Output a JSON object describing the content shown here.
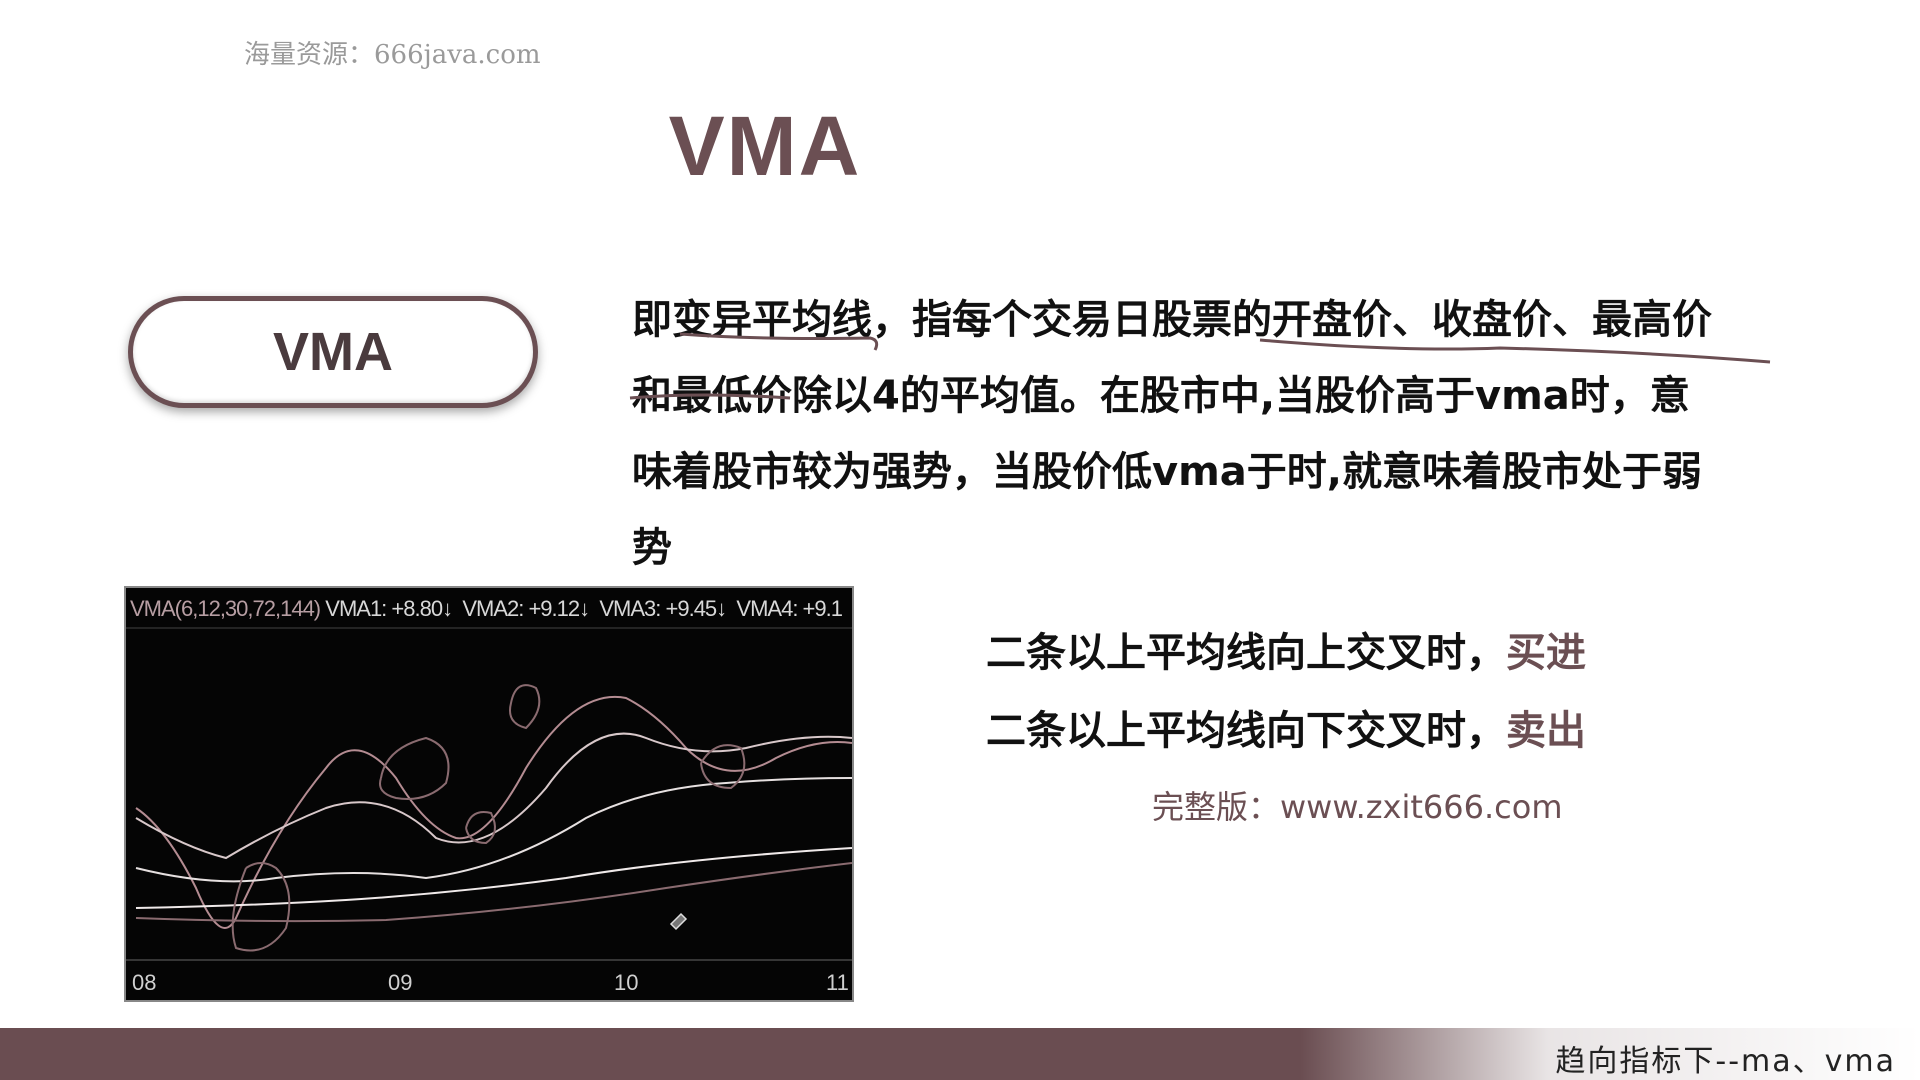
{
  "watermark": "海量资源：666java.com",
  "title": "VMA",
  "pill_label": "VMA",
  "description": {
    "line1": "即变异平均线，指每个交易日股票的开盘价、收盘价、最高价",
    "line2": "和最低价除以4的平均值。在股市中,当股价高于vma时，意",
    "line3": "味着股市较为强势，当股价低vma于时,就意味着股市处于弱",
    "line4": "势"
  },
  "chart": {
    "legend_prefix": "VMA(6,12,30,72,144)",
    "legend_items": [
      {
        "label": "VMA1: +8.80"
      },
      {
        "label": "VMA2: +9.12"
      },
      {
        "label": "VMA3: +9.45"
      },
      {
        "label": "VMA4: +9.1"
      }
    ],
    "x_labels": [
      "08",
      "09",
      "10",
      "11"
    ],
    "arrow_glyph": "↓"
  },
  "rules": {
    "buy_prefix": "二条以上平均线向上交叉时，",
    "buy_action": "买进",
    "sell_prefix": "二条以上平均线向下交叉时，",
    "sell_action": "卖出"
  },
  "full_version": "完整版：www.zxit666.com",
  "footer_text": "趋向指标下--ma、vma",
  "colors": {
    "accent": "#6b4f53",
    "footer": "#6a4d51",
    "chart_bg": "#050505"
  }
}
